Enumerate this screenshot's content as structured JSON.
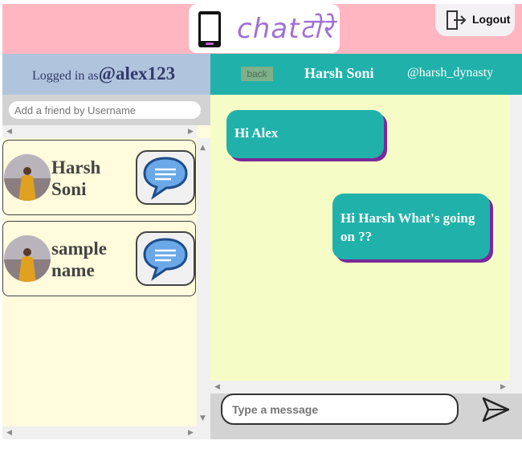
{
  "header": {
    "logo_text": "chatटोरे",
    "logout_label": "Logout"
  },
  "user_bar": {
    "prefix": "Logged in as",
    "username": "@alex123"
  },
  "chat_header": {
    "back_label": "back",
    "name": "Harsh Soni",
    "handle": "@harsh_dynasty"
  },
  "search": {
    "placeholder": "Add a friend by Username"
  },
  "friends": [
    {
      "name": "Harsh Soni",
      "avatar": "person-photo",
      "action_icon": "speech-bubble-icon"
    },
    {
      "name": "sample name",
      "avatar": "person-photo",
      "action_icon": "speech-bubble-icon"
    }
  ],
  "messages": [
    {
      "direction": "incoming",
      "text": "Hi Alex"
    },
    {
      "direction": "outgoing",
      "text": "Hi Harsh What's going on ??"
    }
  ],
  "composer": {
    "placeholder": "Type a message",
    "send_icon": "send-icon"
  },
  "colors": {
    "header_bg": "#ffb6c1",
    "user_bar_bg": "#b0c4de",
    "chat_header_bg": "#20b2aa",
    "friend_panel_bg": "#fffbdc",
    "messages_bg": "#f6fcc5",
    "bubble_bg": "#20b2aa",
    "bubble_shadow": "#7a2a9a"
  }
}
